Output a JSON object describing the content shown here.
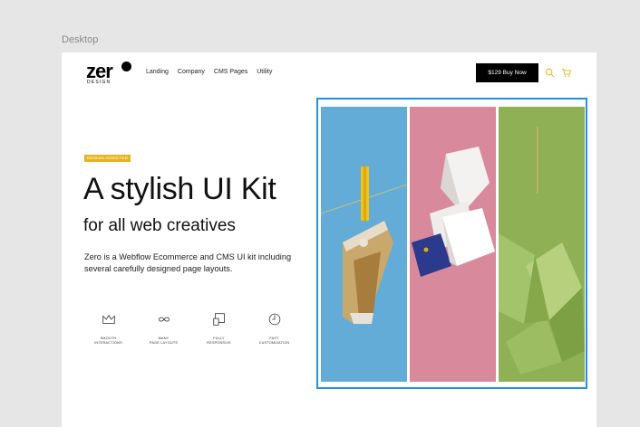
{
  "frame": {
    "label": "Desktop"
  },
  "header": {
    "logo": {
      "word": "zer",
      "sub": "DESIGN"
    },
    "nav": [
      "Landing",
      "Company",
      "CMS Pages",
      "Utility"
    ],
    "buy_label": "$129 Buy Now",
    "icons": [
      "search-icon",
      "cart-icon"
    ]
  },
  "hero": {
    "tag": "DESIGN ADDICTED",
    "title": "A stylish UI Kit",
    "subtitle": "for all web creatives",
    "description": "Zero is a Webflow Ecommerce and CMS UI kit including several carefully designed page layouts."
  },
  "features": [
    {
      "icon": "crown-icon",
      "line1": "SMOOTH",
      "line2": "INTERACTIONS"
    },
    {
      "icon": "infinity-icon",
      "line1": "MANY",
      "line2": "PAGE LAYOUTS"
    },
    {
      "icon": "responsive-icon",
      "line1": "FULLY",
      "line2": "RESPONSIVE"
    },
    {
      "icon": "clock-icon",
      "line1": "FAST",
      "line2": "CUSTOMIZATION"
    }
  ],
  "colors": {
    "accent": "#e3b51d",
    "selection": "#2a8ee0",
    "photo_blue": "#63acd8",
    "photo_pink": "#d88a9c",
    "photo_green": "#8fb055"
  }
}
